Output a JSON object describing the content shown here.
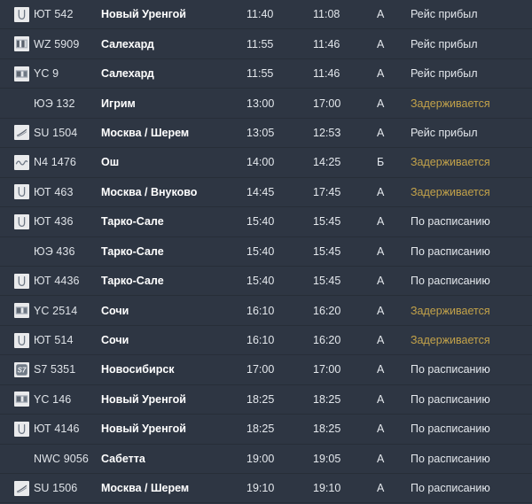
{
  "board": {
    "type": "arrivals",
    "colors": {
      "background": "#2e3643",
      "row_separator": "#3c4553",
      "text_primary": "#e4e8ed",
      "text_destination": "#ffffff",
      "status_delayed": "#c3a24a",
      "logo_background": "#e9eaec"
    },
    "status_labels": {
      "arrived": "Рейс прибыл",
      "delayed": "Задерживается",
      "scheduled": "По расписанию"
    },
    "rows": [
      {
        "logo": "utair-logo-icon",
        "flight": "ЮТ 542",
        "destination": "Новый Уренгой",
        "scheduled_time": "11:40",
        "estimated_time": "11:08",
        "terminal": "А",
        "status": "Рейс прибыл",
        "status_kind": "arrived"
      },
      {
        "logo": "redwings-logo-icon",
        "flight": "WZ 5909",
        "destination": "Салехард",
        "scheduled_time": "11:55",
        "estimated_time": "11:46",
        "terminal": "А",
        "status": "Рейс прибыл",
        "status_kind": "arrived"
      },
      {
        "logo": "yamal-logo-icon",
        "flight": "YC 9",
        "destination": "Салехард",
        "scheduled_time": "11:55",
        "estimated_time": "11:46",
        "terminal": "А",
        "status": "Рейс прибыл",
        "status_kind": "arrived"
      },
      {
        "logo": "none",
        "flight": "ЮЭ 132",
        "destination": "Игрим",
        "scheduled_time": "13:00",
        "estimated_time": "17:00",
        "terminal": "А",
        "status": "Задерживается",
        "status_kind": "delayed"
      },
      {
        "logo": "aeroflot-logo-icon",
        "flight": "SU 1504",
        "destination": "Москва / Шерем",
        "scheduled_time": "13:05",
        "estimated_time": "12:53",
        "terminal": "А",
        "status": "Рейс прибыл",
        "status_kind": "arrived"
      },
      {
        "logo": "nordwind-logo-icon",
        "flight": "N4 1476",
        "destination": "Ош",
        "scheduled_time": "14:00",
        "estimated_time": "14:25",
        "terminal": "Б",
        "status": "Задерживается",
        "status_kind": "delayed"
      },
      {
        "logo": "utair-logo-icon",
        "flight": "ЮТ 463",
        "destination": "Москва / Внуково",
        "scheduled_time": "14:45",
        "estimated_time": "17:45",
        "terminal": "А",
        "status": "Задерживается",
        "status_kind": "delayed"
      },
      {
        "logo": "utair-logo-icon",
        "flight": "ЮТ 436",
        "destination": "Тарко-Сале",
        "scheduled_time": "15:40",
        "estimated_time": "15:45",
        "terminal": "А",
        "status": "По расписанию",
        "status_kind": "scheduled"
      },
      {
        "logo": "none",
        "flight": "ЮЭ 436",
        "destination": "Тарко-Сале",
        "scheduled_time": "15:40",
        "estimated_time": "15:45",
        "terminal": "А",
        "status": "По расписанию",
        "status_kind": "scheduled"
      },
      {
        "logo": "utair-logo-icon",
        "flight": "ЮТ 4436",
        "destination": "Тарко-Сале",
        "scheduled_time": "15:40",
        "estimated_time": "15:45",
        "terminal": "А",
        "status": "По расписанию",
        "status_kind": "scheduled"
      },
      {
        "logo": "yamal-logo-icon",
        "flight": "YC 2514",
        "destination": "Сочи",
        "scheduled_time": "16:10",
        "estimated_time": "16:20",
        "terminal": "А",
        "status": "Задерживается",
        "status_kind": "delayed"
      },
      {
        "logo": "utair-logo-icon",
        "flight": "ЮТ 514",
        "destination": "Сочи",
        "scheduled_time": "16:10",
        "estimated_time": "16:20",
        "terminal": "А",
        "status": "Задерживается",
        "status_kind": "delayed"
      },
      {
        "logo": "s7-logo-icon",
        "flight": "S7 5351",
        "destination": "Новосибирск",
        "scheduled_time": "17:00",
        "estimated_time": "17:00",
        "terminal": "А",
        "status": "По расписанию",
        "status_kind": "scheduled"
      },
      {
        "logo": "yamal-logo-icon",
        "flight": "YC 146",
        "destination": "Новый Уренгой",
        "scheduled_time": "18:25",
        "estimated_time": "18:25",
        "terminal": "А",
        "status": "По расписанию",
        "status_kind": "scheduled"
      },
      {
        "logo": "utair-logo-icon",
        "flight": "ЮТ 4146",
        "destination": "Новый Уренгой",
        "scheduled_time": "18:25",
        "estimated_time": "18:25",
        "terminal": "А",
        "status": "По расписанию",
        "status_kind": "scheduled"
      },
      {
        "logo": "none",
        "flight": "NWC 9056",
        "destination": "Сабетта",
        "scheduled_time": "19:00",
        "estimated_time": "19:05",
        "terminal": "А",
        "status": "По расписанию",
        "status_kind": "scheduled"
      },
      {
        "logo": "aeroflot-logo-icon",
        "flight": "SU 1506",
        "destination": "Москва / Шерем",
        "scheduled_time": "19:10",
        "estimated_time": "19:10",
        "terminal": "А",
        "status": "По расписанию",
        "status_kind": "scheduled"
      }
    ]
  }
}
